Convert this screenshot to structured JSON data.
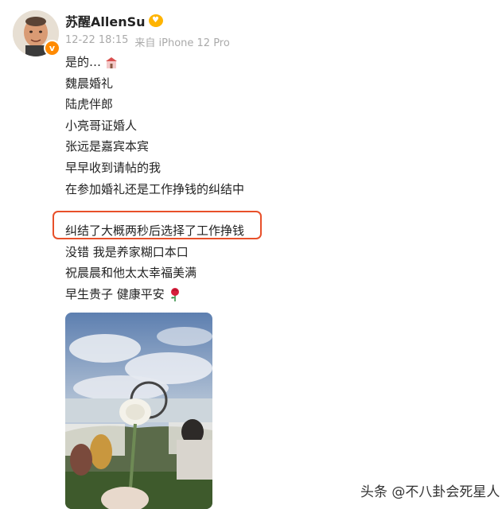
{
  "post": {
    "username": "苏醒AllenSu",
    "vip_icon": "crown-heart-icon",
    "date": "12-22 18:15",
    "source": "来自 iPhone 12 Pro",
    "lines": [
      "是的…",
      "魏晨婚礼",
      "陆虎伴郎",
      "小亮哥证婚人",
      "张远是嘉宾本宾",
      "早早收到请帖的我",
      "在参加婚礼还是工作挣钱的纠结中"
    ],
    "lines2": [
      "纠结了大概两秒后选择了工作挣钱",
      "没错 我是养家糊口本口",
      "祝晨晨和他太太幸福美满",
      "早生贵子 健康平安"
    ],
    "highlight_color": "#e8502a"
  },
  "watermark": "头条 @不八卦会死星人"
}
